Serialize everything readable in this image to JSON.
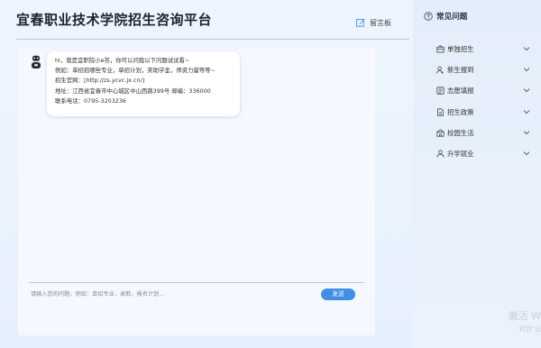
{
  "header": {
    "title": "宜春职业技术学院招生咨询平台",
    "message_board_label": "留言板",
    "message_board_icon": "edit-icon"
  },
  "chat": {
    "bot_message": {
      "line1": "hi，我是宜职院小e答，你可以问我以下问题试试看~",
      "line2": "例如：单招招哪些专业，单招计划，奖助学金，师资力量等等~",
      "line3": "招生官网：[http://zs.ycvc.jx.cn/]",
      "line4": "地址：江西省宜春市中心城区中山西路399号    邮编：336000",
      "line5": "联系电话：0795-3203236"
    },
    "input_placeholder": "请输入您的问题，例如：单招专业，录取，报名计划...",
    "send_label": "发送"
  },
  "sidebar": {
    "heading": "常见问题",
    "heading_icon": "question-circle-icon",
    "items": [
      {
        "label": "单独招生",
        "icon": "box-icon"
      },
      {
        "label": "新生报到",
        "icon": "user-add-icon"
      },
      {
        "label": "志愿填报",
        "icon": "form-icon"
      },
      {
        "label": "招生政策",
        "icon": "document-icon"
      },
      {
        "label": "校园生活",
        "icon": "building-icon"
      },
      {
        "label": "升学就业",
        "icon": "person-icon"
      }
    ]
  },
  "watermark": {
    "line1": "激活 W",
    "line2": "转到\"设"
  },
  "colors": {
    "accent": "#3f8ee8",
    "background": "#e8f1fc",
    "bubble": "#ffffff"
  }
}
